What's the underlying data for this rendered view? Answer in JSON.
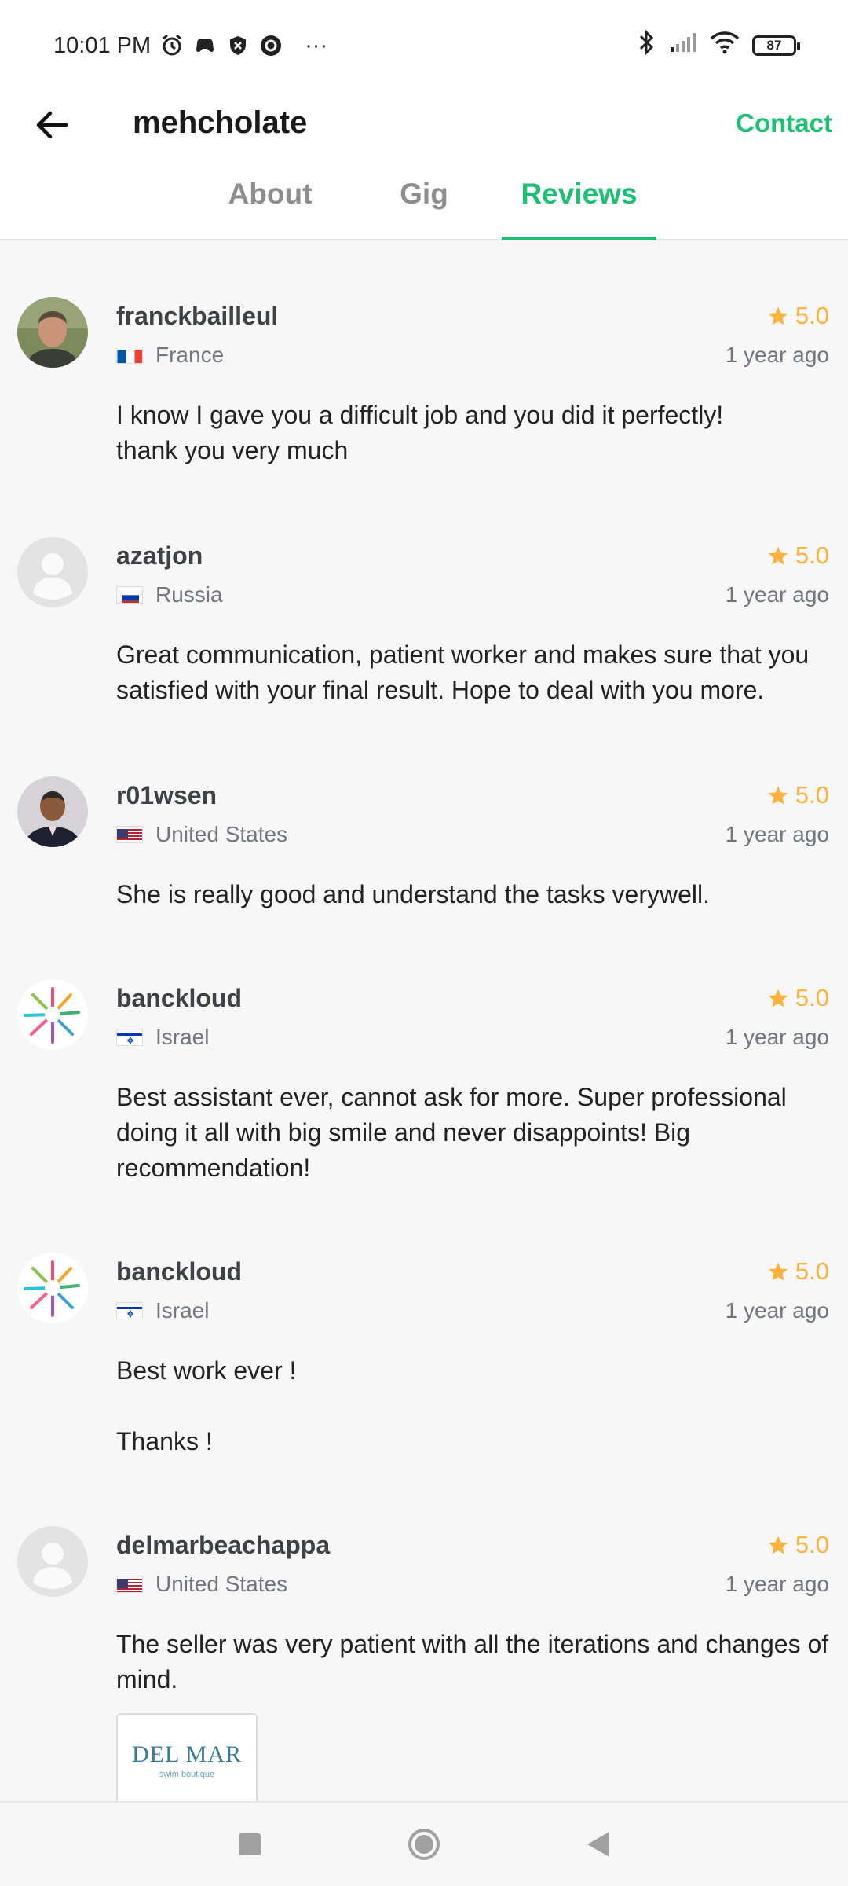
{
  "status_bar": {
    "time": "10:01 PM",
    "more": "···",
    "battery": "87",
    "icons": [
      "alarm-icon",
      "game-icon",
      "shield-icon",
      "record-icon",
      "bluetooth-icon",
      "signal-icon",
      "wifi-icon",
      "battery-icon"
    ]
  },
  "header": {
    "title": "mehcholate",
    "contact_label": "Contact",
    "back_icon": "back-arrow-icon"
  },
  "tabs": [
    {
      "label": "About",
      "active": false
    },
    {
      "label": "Gig",
      "active": false
    },
    {
      "label": "Reviews",
      "active": true
    }
  ],
  "colors": {
    "accent": "#1dbf73",
    "star": "#ffb33e",
    "muted": "#74767e"
  },
  "reviews": [
    {
      "username": "franckbailleul",
      "country": "France",
      "rating": "5.0",
      "time": "1 year ago",
      "comment": "I know I gave you a difficult job and you did it perfectly!\nthank you very much",
      "avatar": "photo"
    },
    {
      "username": "azatjon",
      "country": "Russia",
      "rating": "5.0",
      "time": "1 year ago",
      "comment": "Great communication, patient worker and makes sure that you satisfied with your final result. Hope to deal with you more.",
      "avatar": "placeholder"
    },
    {
      "username": "r01wsen",
      "country": "United States",
      "rating": "5.0",
      "time": "1 year ago",
      "comment": "She is really good and understand the tasks verywell.",
      "avatar": "photo"
    },
    {
      "username": "banckloud",
      "country": "Israel",
      "rating": "5.0",
      "time": "1 year ago",
      "comment": "Best assistant ever, cannot ask for more. Super professional doing it all with big smile and never disappoints! Big recommendation!",
      "avatar": "burst"
    },
    {
      "username": "banckloud",
      "country": "Israel",
      "rating": "5.0",
      "time": "1 year ago",
      "comment": "Best work ever !\n\nThanks !",
      "avatar": "burst"
    },
    {
      "username": "delmarbeachappa",
      "country": "United States",
      "rating": "5.0",
      "time": "1 year ago",
      "comment": "The seller was very patient with all the iterations and changes of mind.",
      "avatar": "placeholder",
      "attachment": {
        "logo_text": "DEL MAR",
        "logo_sub": "swim boutique"
      }
    }
  ],
  "navbar": [
    "recents-button",
    "home-button",
    "back-button"
  ]
}
